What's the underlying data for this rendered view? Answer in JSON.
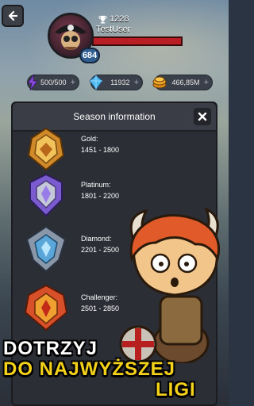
{
  "header": {
    "trophy_count": "1228",
    "username": "TestUser",
    "level": "684"
  },
  "resources": [
    {
      "icon": "energy-bolt-icon",
      "value": "500/500",
      "plus": "+"
    },
    {
      "icon": "blue-gem-icon",
      "value": "11932",
      "plus": "+"
    },
    {
      "icon": "gold-coins-icon",
      "value": "466,85M",
      "plus": "+"
    }
  ],
  "panel": {
    "title": "Season information",
    "close_icon": "close-icon",
    "ranks": [
      {
        "name": "Gold:",
        "range": "1451 - 1800",
        "color": "#d08a2a"
      },
      {
        "name": "Platinum:",
        "range": "1801 - 2200",
        "color": "#7b5bd0"
      },
      {
        "name": "Diamond:",
        "range": "2201 - 2500",
        "color": "#5aa6d8"
      },
      {
        "name": "Challenger:",
        "range": "2501 - 2850",
        "color": "#d8502a"
      }
    ]
  },
  "promo": {
    "line1": "DOTRZYJ",
    "line2": "DO NAJWYŻSZEJ",
    "line3": "LIGI"
  },
  "colors": {
    "accent_yellow": "#f5d21a",
    "hp_red": "#b81e24",
    "panel_bg": "#2b2e35"
  }
}
